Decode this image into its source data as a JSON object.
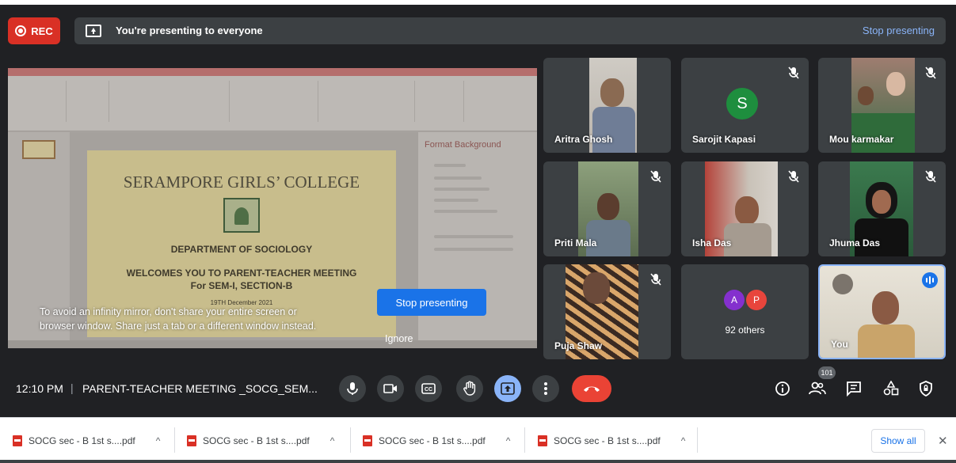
{
  "banner": {
    "rec_label": "REC",
    "presenting_text": "You're presenting to everyone",
    "stop_link": "Stop presenting"
  },
  "presentation": {
    "slide_title": "SERAMPORE GIRLS’ COLLEGE",
    "department": "DEPARTMENT OF SOCIOLOGY",
    "welcome": "WELCOMES YOU TO PARENT-TEACHER MEETING",
    "section": "For SEM-I, SECTION-B",
    "date": "19TH December 2021",
    "pane_title": "Format Background"
  },
  "overlay": {
    "message_line1": "To avoid an infinity mirror, don't share your entire screen or",
    "message_line2": "browser window. Share just a tab or a different window instead.",
    "stop_button": "Stop presenting",
    "ignore": "Ignore"
  },
  "participants": [
    {
      "name": "Aritra Ghosh",
      "muted": false
    },
    {
      "name": "Sarojit Kapasi",
      "initial": "S",
      "muted": true
    },
    {
      "name": "Mou karmakar",
      "muted": true
    },
    {
      "name": "Priti Mala",
      "muted": true
    },
    {
      "name": "Isha Das",
      "muted": true
    },
    {
      "name": "Jhuma Das",
      "muted": true
    },
    {
      "name": "Puja Shaw",
      "muted": true
    },
    {
      "name": "92 others",
      "initials": [
        "A",
        "P"
      ]
    },
    {
      "name": "You",
      "speaking": true
    }
  ],
  "bottom_bar": {
    "time": "12:10 PM",
    "separator": "|",
    "meeting_title": "PARENT-TEACHER MEETING _SOCG_SEM...",
    "people_count": "101"
  },
  "downloads": {
    "items": [
      {
        "name": "SOCG sec - B 1st s....pdf"
      },
      {
        "name": "SOCG sec - B 1st s....pdf"
      },
      {
        "name": "SOCG sec - B 1st s....pdf"
      },
      {
        "name": "SOCG sec - B 1st s....pdf"
      }
    ],
    "show_all": "Show all",
    "close": "✕",
    "caret": "^"
  },
  "colors": {
    "background": "#202124",
    "tile": "#3c4043",
    "accent_blue": "#1a73e8",
    "rec_red": "#d93025",
    "end_call": "#ea4335",
    "link_blue": "#8ab4f8"
  },
  "icons": [
    "mic-icon",
    "camera-icon",
    "captions-icon",
    "raise-hand-icon",
    "present-icon",
    "more-options-icon",
    "end-call-icon",
    "info-icon",
    "people-icon",
    "chat-icon",
    "activities-icon",
    "host-controls-icon",
    "mic-off-icon",
    "pdf-icon"
  ]
}
